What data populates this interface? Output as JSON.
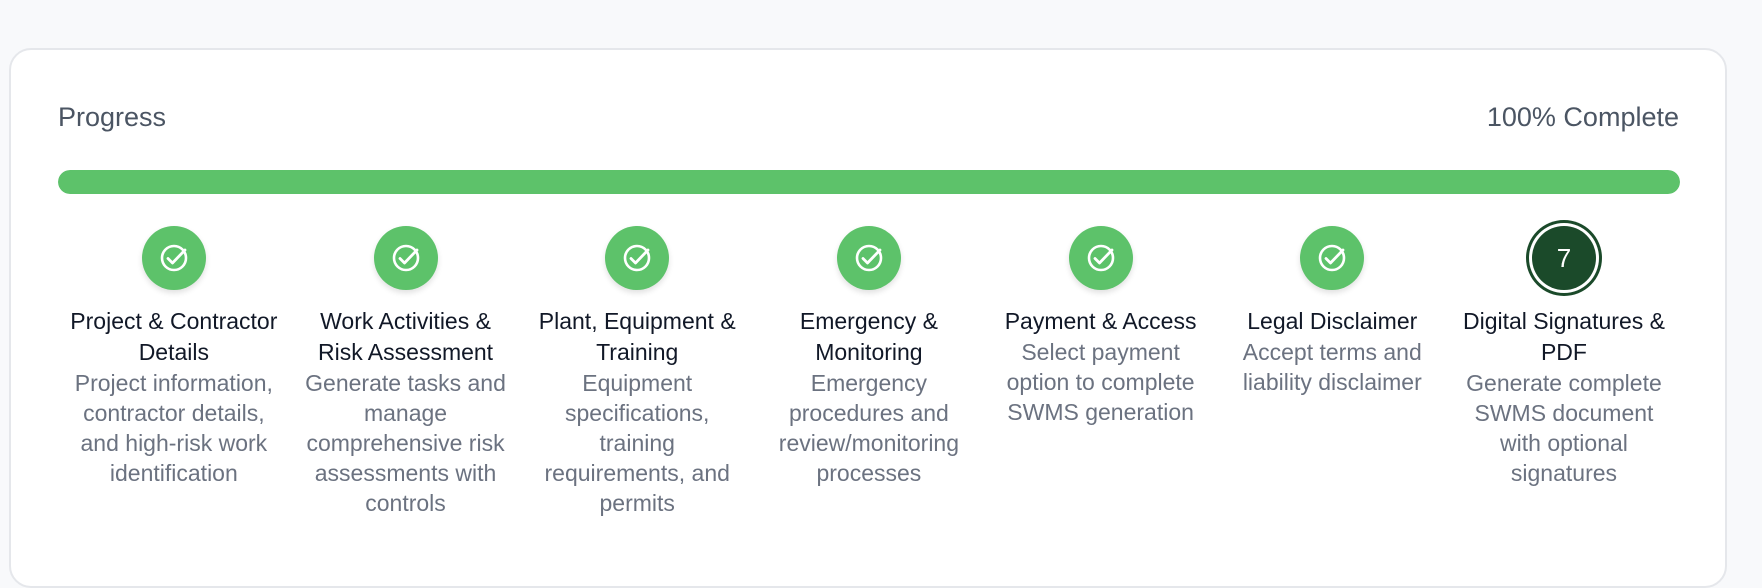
{
  "progress": {
    "title": "Progress",
    "percent_label": "100% Complete",
    "value": 1.0,
    "fill_color": "#5dc26a"
  },
  "steps": [
    {
      "status": "complete",
      "icon": "check-circle-icon",
      "title": "Project & Contractor Details",
      "description": "Project information, contractor details, and high-risk work identification"
    },
    {
      "status": "complete",
      "icon": "check-circle-icon",
      "title": "Work Activities & Risk Assessment",
      "description": "Generate tasks and manage comprehensive risk assessments with controls"
    },
    {
      "status": "complete",
      "icon": "check-circle-icon",
      "title": "Plant, Equipment & Training",
      "description": "Equipment specifications, training requirements, and permits"
    },
    {
      "status": "complete",
      "icon": "check-circle-icon",
      "title": "Emergency & Monitoring",
      "description": "Emergency procedures and review/monitoring processes"
    },
    {
      "status": "complete",
      "icon": "check-circle-icon",
      "title": "Payment & Access",
      "description": "Select payment option to complete SWMS generation"
    },
    {
      "status": "complete",
      "icon": "check-circle-icon",
      "title": "Legal Disclaimer",
      "description": "Accept terms and liability disclaimer"
    },
    {
      "status": "current",
      "number": "7",
      "title": "Digital Signatures & PDF",
      "description": "Generate complete SWMS document with optional signatures"
    }
  ],
  "colors": {
    "complete": "#5dc26a",
    "current": "#1b4a2a"
  }
}
